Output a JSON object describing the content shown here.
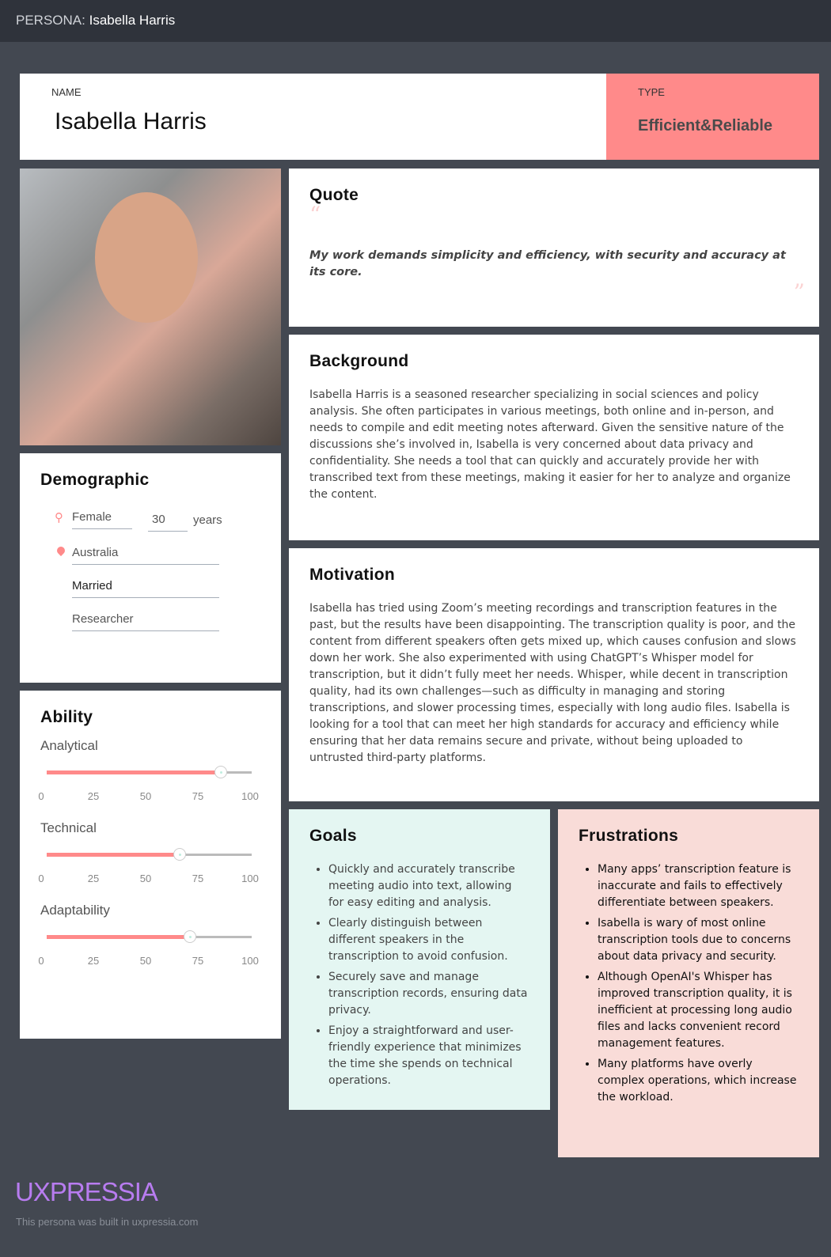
{
  "header": {
    "prefix": "PERSONA:",
    "name": "Isabella Harris"
  },
  "name_card": {
    "label": "NAME",
    "value": "Isabella Harris"
  },
  "type_card": {
    "label": "TYPE",
    "value": "Efficient&Reliable",
    "color": "#ff8a8a"
  },
  "quote": {
    "title": "Quote",
    "text": "My work demands simplicity and efficiency, with security and accuracy at its core."
  },
  "background": {
    "title": "Background",
    "text": "Isabella Harris is a seasoned researcher specializing in social sciences and policy analysis. She often participates in various meetings, both online and in-person, and needs to compile and edit meeting notes afterward. Given the sensitive nature of the discussions she’s involved in, Isabella is very concerned about data privacy and confidentiality. She needs a tool that can quickly and accurately provide her with transcribed text from these meetings, making it easier for her to analyze and organize the content."
  },
  "motivation": {
    "title": "Motivation",
    "text": "Isabella has tried using Zoom’s meeting recordings and transcription features in the past, but the results have been disappointing. The transcription quality is poor, and the content from different speakers often gets mixed up, which causes confusion and slows down her work. She also experimented with using ChatGPT’s Whisper model for transcription, but it didn’t fully meet her needs. Whisper, while decent in transcription quality, had its own challenges—such as difficulty in managing and storing transcriptions, and slower processing times, especially with long audio files. Isabella is looking for a tool that can meet her high standards for accuracy and efficiency while ensuring that her data remains secure and private, without being uploaded to untrusted third-party platforms."
  },
  "demographic": {
    "title": "Demographic",
    "gender": "Female",
    "age": "30",
    "age_unit": "years",
    "location": "Australia",
    "status": "Married",
    "occupation": "Researcher"
  },
  "ability": {
    "title": "Ability",
    "ticks": [
      "0",
      "25",
      "50",
      "75",
      "100"
    ],
    "items": [
      {
        "label": "Analytical",
        "value": 85
      },
      {
        "label": "Technical",
        "value": 65
      },
      {
        "label": "Adaptability",
        "value": 70
      }
    ]
  },
  "goals": {
    "title": "Goals",
    "items": [
      "Quickly and accurately transcribe meeting audio into text, allowing for easy editing and analysis.",
      "Clearly distinguish between different speakers in the transcription to avoid confusion.",
      "Securely save and manage transcription records, ensuring data privacy.",
      "Enjoy a straightforward and user-friendly experience that minimizes the time she spends on technical operations."
    ]
  },
  "frustrations": {
    "title": "Frustrations",
    "items": [
      "Many apps’ transcription feature is inaccurate and fails to effectively differentiate between speakers.",
      "Isabella is wary of most online transcription tools due to concerns about data privacy and security.",
      "Although OpenAI's Whisper has improved transcription quality, it is inefficient at processing long audio files and lacks convenient record management features.",
      "Many platforms have overly complex operations, which increase the workload."
    ]
  },
  "footer": {
    "logo": "UXPRESSIA",
    "note": "This persona was built in uxpressia.com"
  }
}
